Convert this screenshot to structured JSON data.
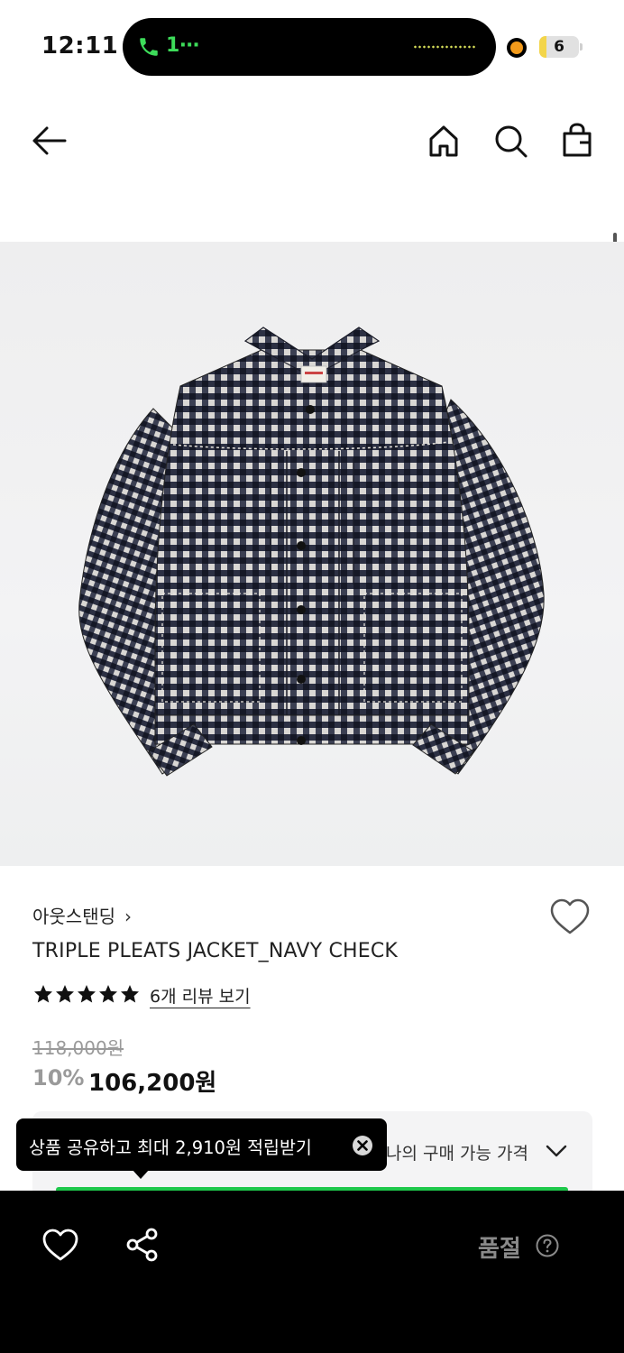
{
  "status_bar": {
    "time": "12:11",
    "call_indicator": "1⋯",
    "battery_level": "6",
    "icons": [
      "phone-icon",
      "recording-dot-icon",
      "battery-icon"
    ]
  },
  "nav": {
    "icons": [
      "back-arrow-icon",
      "home-icon",
      "search-icon",
      "shopping-bag-icon"
    ]
  },
  "product": {
    "image_description": "navy check cropped jacket",
    "brand": "아웃스탠딩",
    "brand_chevron": "›",
    "title": "TRIPLE PLEATS JACKET_NAVY CHECK",
    "rating_stars": 5,
    "review_link": "6개 리뷰 보기",
    "original_price": "118,000원",
    "discount": "10%",
    "sale_price": "106,200원"
  },
  "price_panel": {
    "label": "나의 구매 가능 가격"
  },
  "tooltip": {
    "text": "상품 공유하고 최대 2,910원 적립받기"
  },
  "bottom_bar": {
    "status": "품절",
    "icons": [
      "heart-icon",
      "share-icon",
      "help-icon"
    ]
  },
  "colors": {
    "accent_green": "#1ec84b",
    "call_green": "#3ddc5a",
    "muted_gray": "#9a9a9a",
    "bar_black": "#000000"
  }
}
